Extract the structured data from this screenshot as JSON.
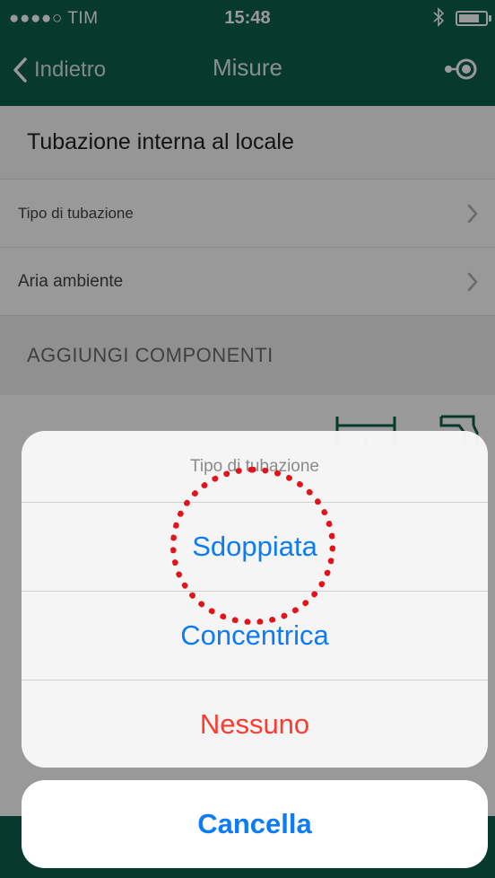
{
  "status_bar": {
    "carrier": "●●●●○ TIM",
    "time": "15:48",
    "bluetooth_icon": "bluetooth-icon",
    "battery_icon": "battery-icon"
  },
  "nav": {
    "back_label": "Indietro",
    "title": "Misure",
    "right_icon": "locate-icon"
  },
  "page": {
    "section_title": "Tubazione interna al locale",
    "rows": [
      {
        "label": "Tipo di tubazione"
      },
      {
        "label": "Aria ambiente"
      }
    ],
    "components_header": "AGGIUNGI COMPONENTI"
  },
  "action_sheet": {
    "title": "Tipo di tubazione",
    "options": [
      "Sdoppiata",
      "Concentrica"
    ],
    "destructive_option": "Nessuno",
    "cancel_label": "Cancella",
    "accent_color": "#0b7bf6",
    "destructive_color": "#ff3b30"
  },
  "colors": {
    "nav_bar": "#0c5f4c",
    "annotation": "#e0141a"
  }
}
